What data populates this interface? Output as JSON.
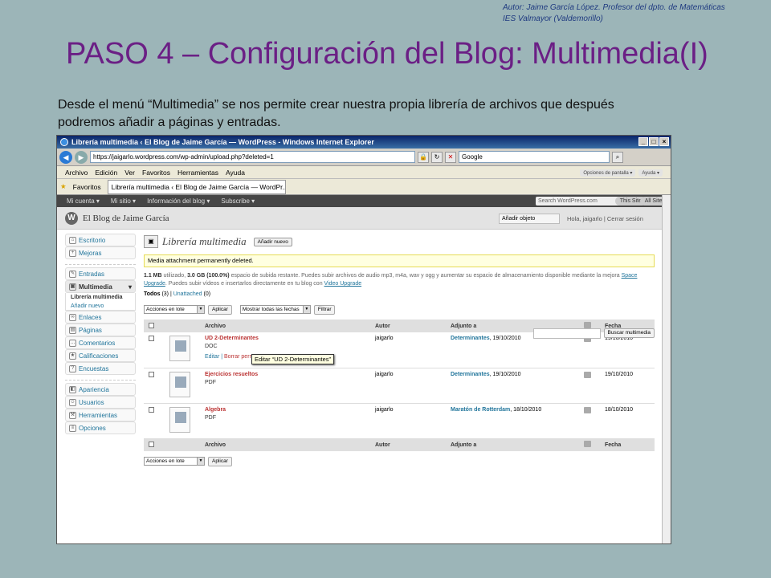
{
  "slide": {
    "author_line1": "Autor: Jaime García López. Profesor del dpto. de Matemáticas",
    "author_line2": "IES Valmayor (Valdemorillo)",
    "title": "PASO 4 – Configuración del Blog: Multimedia(I)",
    "description": "Desde el menú “Multimedia” se nos permite crear nuestra propia librería de archivos que después podremos añadir a páginas y entradas."
  },
  "browser": {
    "window_title": "Librería multimedia ‹ El Blog de Jaime García — WordPress - Windows Internet Explorer",
    "url": "https://jaigarlo.wordpress.com/wp-admin/upload.php?deleted=1",
    "search_placeholder": "Google",
    "menu": [
      "Archivo",
      "Edición",
      "Ver",
      "Favoritos",
      "Herramientas",
      "Ayuda"
    ],
    "favorites_label": "Favoritos",
    "tab_label": "Librería multimedia ‹ El Blog de Jaime García — WordPr..."
  },
  "wp": {
    "adminbar": [
      "Mi cuenta ▾",
      "Mi sitio ▾",
      "Información del blog ▾",
      "Subscribe ▾"
    ],
    "adminbar_search": "Search WordPress.com",
    "this_site": "This Site",
    "all_sites": "All Sites",
    "blog_name": "El Blog de Jaime García",
    "add_object": "Añadir objeto",
    "greeting": "Hola, jaigarlo | Cerrar sesión",
    "screen_options": "Opciones de pantalla ▾",
    "help": "Ayuda ▾",
    "sidebar": {
      "escritorio": "Escritorio",
      "mejoras": "Mejoras",
      "entradas": "Entradas",
      "multimedia": "Multimedia",
      "libreria": "Librería multimedia",
      "anadir_nuevo": "Añadir nuevo",
      "enlaces": "Enlaces",
      "paginas": "Páginas",
      "comentarios": "Comentarios",
      "calificaciones": "Calificaciones",
      "encuestas": "Encuestas",
      "apariencia": "Apariencia",
      "usuarios": "Usuarios",
      "herramientas": "Herramientas",
      "opciones": "Opciones"
    },
    "page_title": "Librería multimedia",
    "add_new_button": "Añadir nuevo",
    "notice": "Media attachment permanently deleted.",
    "space_used": "1.1 MB",
    "space_text1": " utilizado, ",
    "space_free": "3.0 GB (100.0%)",
    "space_text2": " espacio de subida restante. Puedes subir archivos de audio mp3, m4a, wav y ogg y aumentar su espacio de almacenamiento disponible mediante la mejora ",
    "space_upgrade": "Space Upgrade",
    "space_text3": ". Puedes subir vídeos e insertarlos directamente en tu blog con ",
    "video_upgrade": "Video Upgrade",
    "filter_all": "Todos",
    "filter_all_count": "(3)",
    "filter_unattached": "Unattached",
    "filter_unattached_count": "(0)",
    "search_button": "Buscar multimedia",
    "bulk_actions": "Acciones en lote",
    "apply": "Aplicar",
    "show_dates": "Mostrar todas las fechas",
    "filter_button": "Filtrar",
    "columns": {
      "archivo": "Archivo",
      "autor": "Autor",
      "adjunto": "Adjunto a",
      "fecha": "Fecha"
    },
    "rows": [
      {
        "name": "UD 2-Determinantes",
        "type": "DOC",
        "author": "jaigarlo",
        "attached": "Determinantes",
        "attached_date": ", 19/10/2010",
        "date": "19/10/2010",
        "edit": "Editar",
        "delete": "Borrar perm"
      },
      {
        "name": "Ejercicios resueltos",
        "type": "PDF",
        "author": "jaigarlo",
        "attached": "Determinantes",
        "attached_date": ", 19/10/2010",
        "date": "19/10/2010"
      },
      {
        "name": "Algebra",
        "type": "PDF",
        "author": "jaigarlo",
        "attached": "Maratón de Rotterdam",
        "attached_date": ", 18/10/2010",
        "date": "18/10/2010"
      }
    ],
    "tooltip": "Editar “UD 2-Determinantes”"
  }
}
